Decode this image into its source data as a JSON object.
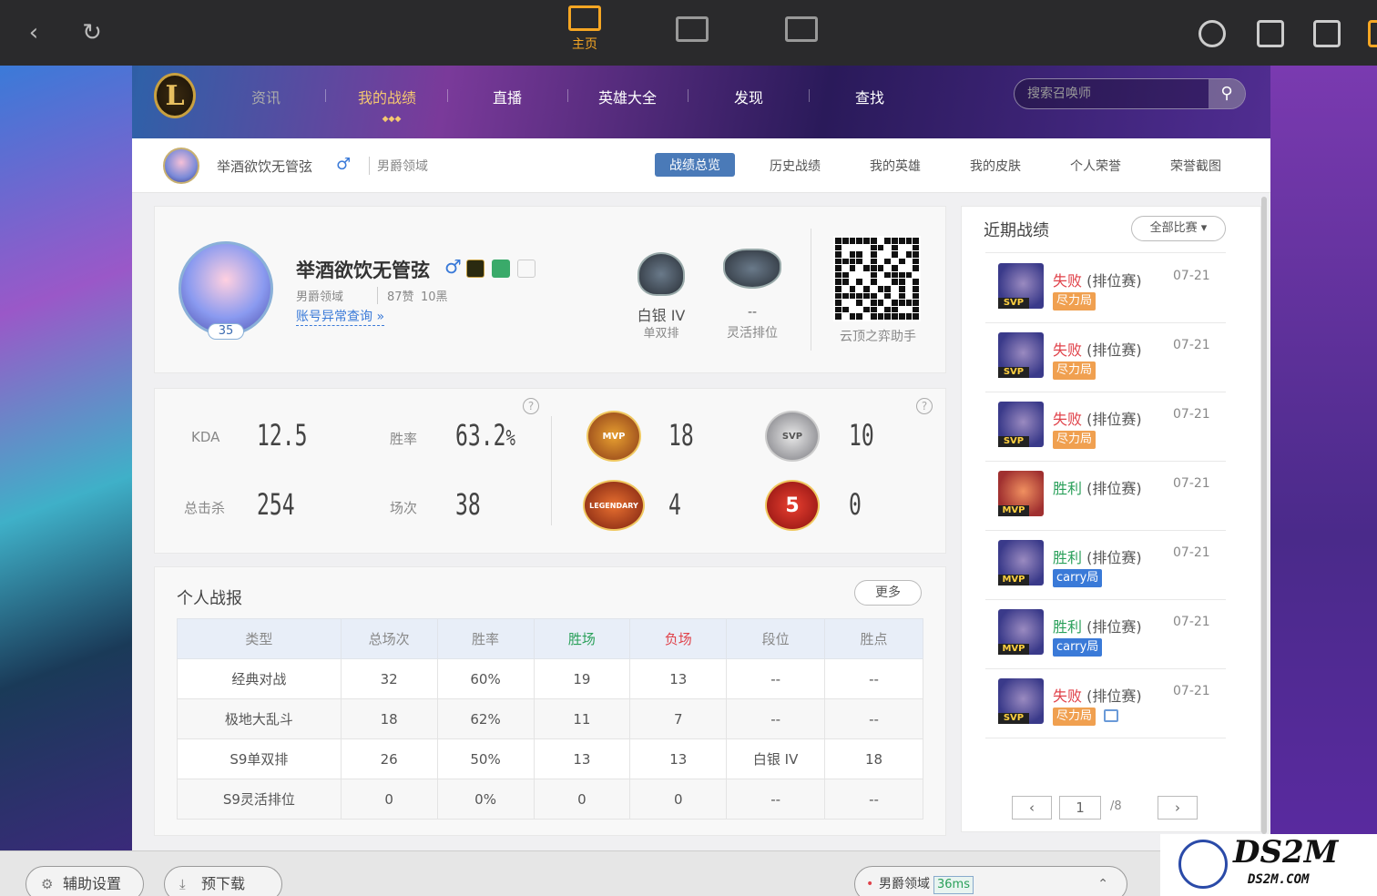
{
  "topbar": {
    "home_label": "主页"
  },
  "nav": {
    "items": [
      "资讯",
      "我的战绩",
      "直播",
      "英雄大全",
      "发现",
      "查找"
    ],
    "search_placeholder": "搜索召唤师"
  },
  "profile": {
    "name": "举酒欲饮无管弦",
    "server": "男爵领域",
    "level": "35",
    "likes": "87赞",
    "blacks": "10黑",
    "abnormal_link": "账号异常查询 »",
    "gender_symbol": "♂"
  },
  "subtabs": [
    "战绩总览",
    "历史战绩",
    "我的英雄",
    "我的皮肤",
    "个人荣誉",
    "荣誉截图"
  ],
  "rank": {
    "solo_tier": "白银 IV",
    "solo_label": "单双排",
    "flex_tier": "--",
    "flex_label": "灵活排位",
    "qr_label": "云顶之弈助手"
  },
  "stats": {
    "kda_label": "KDA",
    "kda": "12.5",
    "winrate_label": "胜率",
    "winrate": "63.2",
    "winrate_unit": "%",
    "kills_label": "总击杀",
    "kills": "254",
    "games_label": "场次",
    "games": "38",
    "mvp_text": "MVP",
    "mvp_count": "18",
    "svp_text": "SVP",
    "svp_count": "10",
    "legendary_text": "LEGENDARY",
    "legendary_count": "4",
    "penta_text": "5",
    "penta_count": "0",
    "help": "?"
  },
  "report": {
    "title": "个人战报",
    "more": "更多",
    "headers": [
      "类型",
      "总场次",
      "胜率",
      "胜场",
      "负场",
      "段位",
      "胜点"
    ],
    "rows": [
      [
        "经典对战",
        "32",
        "60%",
        "19",
        "13",
        "--",
        "--"
      ],
      [
        "极地大乱斗",
        "18",
        "62%",
        "11",
        "7",
        "--",
        "--"
      ],
      [
        "S9单双排",
        "26",
        "50%",
        "13",
        "13",
        "白银 IV",
        "18"
      ],
      [
        "S9灵活排位",
        "0",
        "0%",
        "0",
        "0",
        "--",
        "--"
      ]
    ]
  },
  "recent": {
    "title": "近期战绩",
    "filter": "全部比赛 ▾",
    "matches": [
      {
        "tag": "SVP",
        "result": "失败",
        "type": "(排位赛)",
        "date": "07-21",
        "label": "尽力局"
      },
      {
        "tag": "SVP",
        "result": "失败",
        "type": "(排位赛)",
        "date": "07-21",
        "label": "尽力局"
      },
      {
        "tag": "SVP",
        "result": "失败",
        "type": "(排位赛)",
        "date": "07-21",
        "label": "尽力局"
      },
      {
        "tag": "MVP",
        "result": "胜利",
        "type": "(排位赛)",
        "date": "07-21",
        "label": ""
      },
      {
        "tag": "MVP",
        "result": "胜利",
        "type": "(排位赛)",
        "date": "07-21",
        "label": "carry局"
      },
      {
        "tag": "MVP",
        "result": "胜利",
        "type": "(排位赛)",
        "date": "07-21",
        "label": "carry局"
      },
      {
        "tag": "SVP",
        "result": "失败",
        "type": "(排位赛)",
        "date": "07-21",
        "label": "尽力局"
      }
    ],
    "page": "1",
    "total": "/8"
  },
  "bottom": {
    "assist": "辅助设置",
    "predownload": "预下载",
    "server": "男爵领域",
    "ping": "36ms"
  },
  "watermark": {
    "title": "DS2M",
    "sub": "DS2M.COM"
  }
}
